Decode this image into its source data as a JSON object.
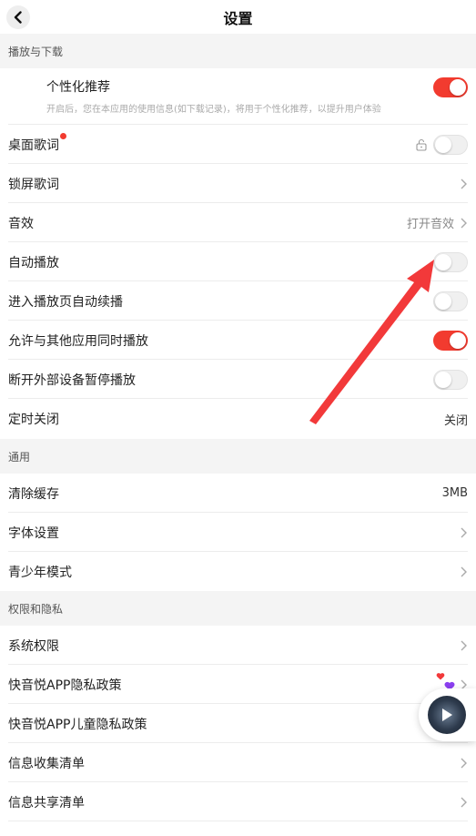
{
  "header": {
    "title": "设置"
  },
  "sections": {
    "playback": {
      "title": "播放与下载",
      "recommend": {
        "title": "个性化推荐",
        "desc": "开启后，您在本应用的使用信息(如下载记录)，将用于个性化推荐，以提升用户体验",
        "on": true
      },
      "desktop_lyrics": {
        "label": "桌面歌词",
        "on": false
      },
      "lockscreen_lyrics": {
        "label": "锁屏歌词"
      },
      "sound_effect": {
        "label": "音效",
        "value": "打开音效"
      },
      "autoplay": {
        "label": "自动播放",
        "on": false
      },
      "continue_play": {
        "label": "进入播放页自动续播",
        "on": false
      },
      "mix_play": {
        "label": "允许与其他应用同时播放",
        "on": true
      },
      "pause_on_disconnect": {
        "label": "断开外部设备暂停播放",
        "on": false
      },
      "sleep_timer": {
        "label": "定时关闭",
        "value": "关闭"
      }
    },
    "general": {
      "title": "通用",
      "clear_cache": {
        "label": "清除缓存",
        "value": "3MB"
      },
      "font_settings": {
        "label": "字体设置"
      },
      "teen_mode": {
        "label": "青少年模式"
      }
    },
    "privacy": {
      "title": "权限和隐私",
      "system_permissions": {
        "label": "系统权限"
      },
      "privacy_policy": {
        "label": "快音悦APP隐私政策"
      },
      "children_policy": {
        "label": "快音悦APP儿童隐私政策"
      },
      "info_collection": {
        "label": "信息收集清单"
      },
      "info_sharing": {
        "label": "信息共享清单"
      }
    }
  },
  "colors": {
    "accent": "#f23b2f",
    "section_bg": "#f4f4f4",
    "arrow": "#f2393a"
  },
  "icons": [
    "back-icon",
    "chevron-right-icon",
    "lock-icon",
    "play-icon",
    "heart-icon"
  ]
}
